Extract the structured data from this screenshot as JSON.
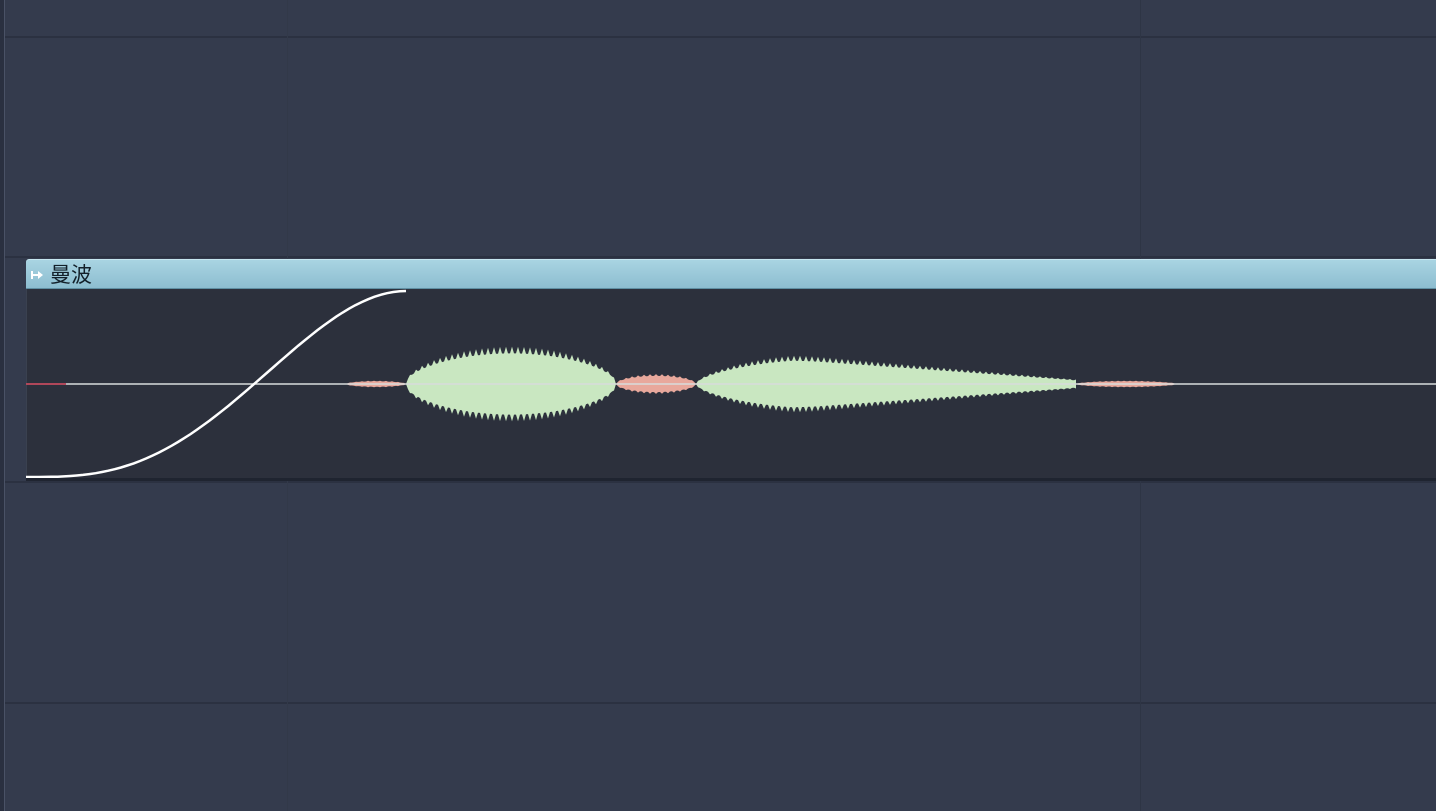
{
  "playlist": {
    "clip": {
      "title": "曼波",
      "header_color": "#9ccbdc",
      "waveform_color": "#c9e7c1",
      "quiet_color": "#e8a89c",
      "automation_color": "#ffffff",
      "icon": "clip-arrow-icon"
    }
  }
}
